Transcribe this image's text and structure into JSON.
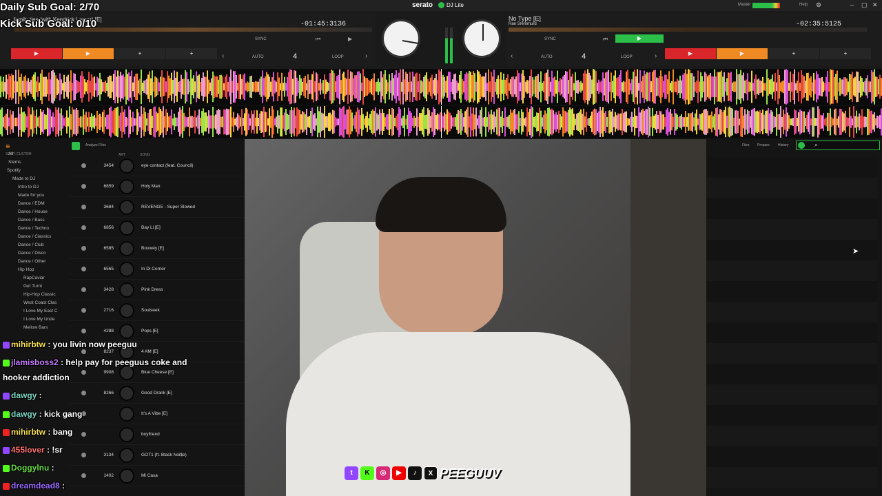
{
  "overlay": {
    "sub_goal": "Daily Sub Goal: 2/70",
    "kick_goal": "Kick Sub Goal: 0/10"
  },
  "app": {
    "name": "serato",
    "product": "DJ Lite",
    "master_label": "Master",
    "help_label": "Help"
  },
  "deck_left": {
    "title": "family ties (with Kendrick Lamar) [E]",
    "time": "-01:45:3",
    "bpm": "136",
    "sync": "SYNC",
    "auto": "AUTO",
    "beats": "4",
    "loop": "LOOP"
  },
  "deck_right": {
    "title": "No Type [E]",
    "artist": "Rae Sremmurd",
    "time": "-02:35:5",
    "bpm": "125",
    "sync": "SYNC",
    "auto": "AUTO",
    "beats": "4",
    "loop": "LOOP"
  },
  "library": {
    "sort_label": "SORT: CUSTOM",
    "analyze_label": "Analyze Files",
    "col_art": "ART",
    "col_song": "SONG",
    "tabs": [
      "Files",
      "Prepare",
      "History"
    ],
    "tree": [
      {
        "label": "All"
      },
      {
        "label": "Stems"
      },
      {
        "label": "Spotify"
      },
      {
        "label": "Made to DJ"
      },
      {
        "label": "Intro to DJ"
      },
      {
        "label": "Made for you"
      },
      {
        "label": "Dance / EDM"
      },
      {
        "label": "Dance / House"
      },
      {
        "label": "Dance / Bass"
      },
      {
        "label": "Dance / Techno"
      },
      {
        "label": "Dance / Classics"
      },
      {
        "label": "Dance / Club"
      },
      {
        "label": "Dance / Disco"
      },
      {
        "label": "Dance / Other"
      },
      {
        "label": "Hip Hop"
      },
      {
        "label": "RapCaviar"
      },
      {
        "label": "Get Turnt"
      },
      {
        "label": "Hip-Hop Classic"
      },
      {
        "label": "West Coast Clas"
      },
      {
        "label": "I Love My East C"
      },
      {
        "label": "I Love My Unde"
      },
      {
        "label": "Mellow Bars"
      }
    ],
    "rows": [
      {
        "num": "3454",
        "song": "eye contact (feat. Council)"
      },
      {
        "num": "6859",
        "song": "Holy Man"
      },
      {
        "num": "3684",
        "song": "REVENGE - Super Slowed"
      },
      {
        "num": "6856",
        "song": "Bay Li [E]"
      },
      {
        "num": "6585",
        "song": "Bouwéy [E]"
      },
      {
        "num": "6565",
        "song": "In Di Corner"
      },
      {
        "num": "3428",
        "song": "Pink Dress"
      },
      {
        "num": "2716",
        "song": "Soulseek"
      },
      {
        "num": "4288",
        "song": "Pops [E]"
      },
      {
        "num": "8237",
        "song": "4 AM [E]"
      },
      {
        "num": "9908",
        "song": "Blue Cheese [E]"
      },
      {
        "num": "8266",
        "song": "Good Drank [E]"
      },
      {
        "num": "",
        "song": "It's A Vibe [E]"
      },
      {
        "num": "",
        "song": "boyfriend"
      },
      {
        "num": "3134",
        "song": "GOT1 (ft. Black Noi$e)"
      },
      {
        "num": "1402",
        "song": "Mi Casa"
      }
    ]
  },
  "chat": [
    {
      "user": "mihirbtw",
      "color": "#f5e050",
      "msg": "you livin now peeguu"
    },
    {
      "user": "jlamisboss2",
      "color": "#c77dff",
      "msg": "help pay for peeguus coke and"
    },
    {
      "user": "",
      "color": "#ffffff",
      "msg": "hooker addiction"
    },
    {
      "user": "dawgy",
      "color": "#7cd8c5",
      "msg": ""
    },
    {
      "user": "dawgy",
      "color": "#7cd8c5",
      "msg": "kick gang"
    },
    {
      "user": "mihirbtw",
      "color": "#f5e050",
      "msg": "bang"
    },
    {
      "user": "455lover",
      "color": "#ff7070",
      "msg": "!sr"
    },
    {
      "user": "Doggylnu",
      "color": "#66dd44",
      "msg": ""
    },
    {
      "user": "dreamdead8",
      "color": "#9b6bff",
      "msg": ""
    }
  ],
  "social": {
    "handle": "PEEGUUV"
  },
  "colors": {
    "accent_red": "#d9262b",
    "accent_orange": "#f08a24",
    "play_green": "#2bbf4a"
  }
}
